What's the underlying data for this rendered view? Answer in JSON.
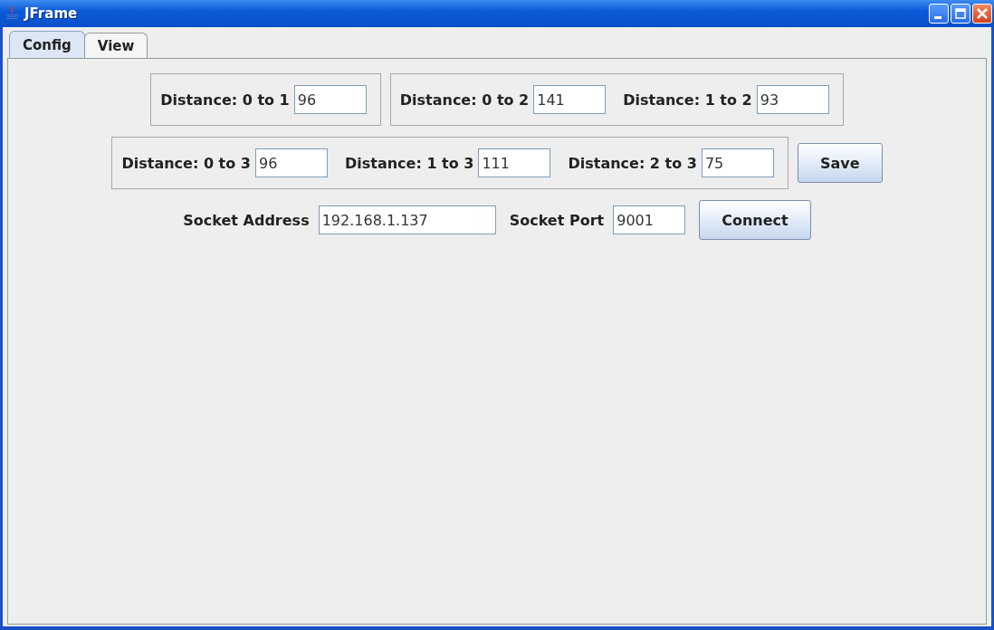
{
  "window": {
    "title": "JFrame"
  },
  "tabs": [
    {
      "label": "Config",
      "selected": true
    },
    {
      "label": "View",
      "selected": false
    }
  ],
  "rows": [
    {
      "items": [
        {
          "kind": "group",
          "fields": [
            {
              "label": "Distance: 0 to 1",
              "value": "96"
            }
          ]
        },
        {
          "kind": "group",
          "fields": [
            {
              "label": "Distance: 0 to 2",
              "value": "141"
            },
            {
              "label": "Distance: 1 to 2",
              "value": "93"
            }
          ]
        }
      ]
    },
    {
      "items": [
        {
          "kind": "group",
          "fields": [
            {
              "label": "Distance: 0 to 3",
              "value": "96"
            },
            {
              "label": "Distance: 1 to 3",
              "value": "111"
            },
            {
              "label": "Distance: 2 to 3",
              "value": "75"
            }
          ]
        },
        {
          "kind": "button",
          "label": "Save"
        }
      ]
    },
    {
      "items": [
        {
          "kind": "field",
          "label": "Socket Address",
          "value": "192.168.1.137",
          "wide": true
        },
        {
          "kind": "field",
          "label": "Socket Port",
          "value": "9001",
          "wide": false
        },
        {
          "kind": "button",
          "label": "Connect"
        }
      ]
    }
  ]
}
